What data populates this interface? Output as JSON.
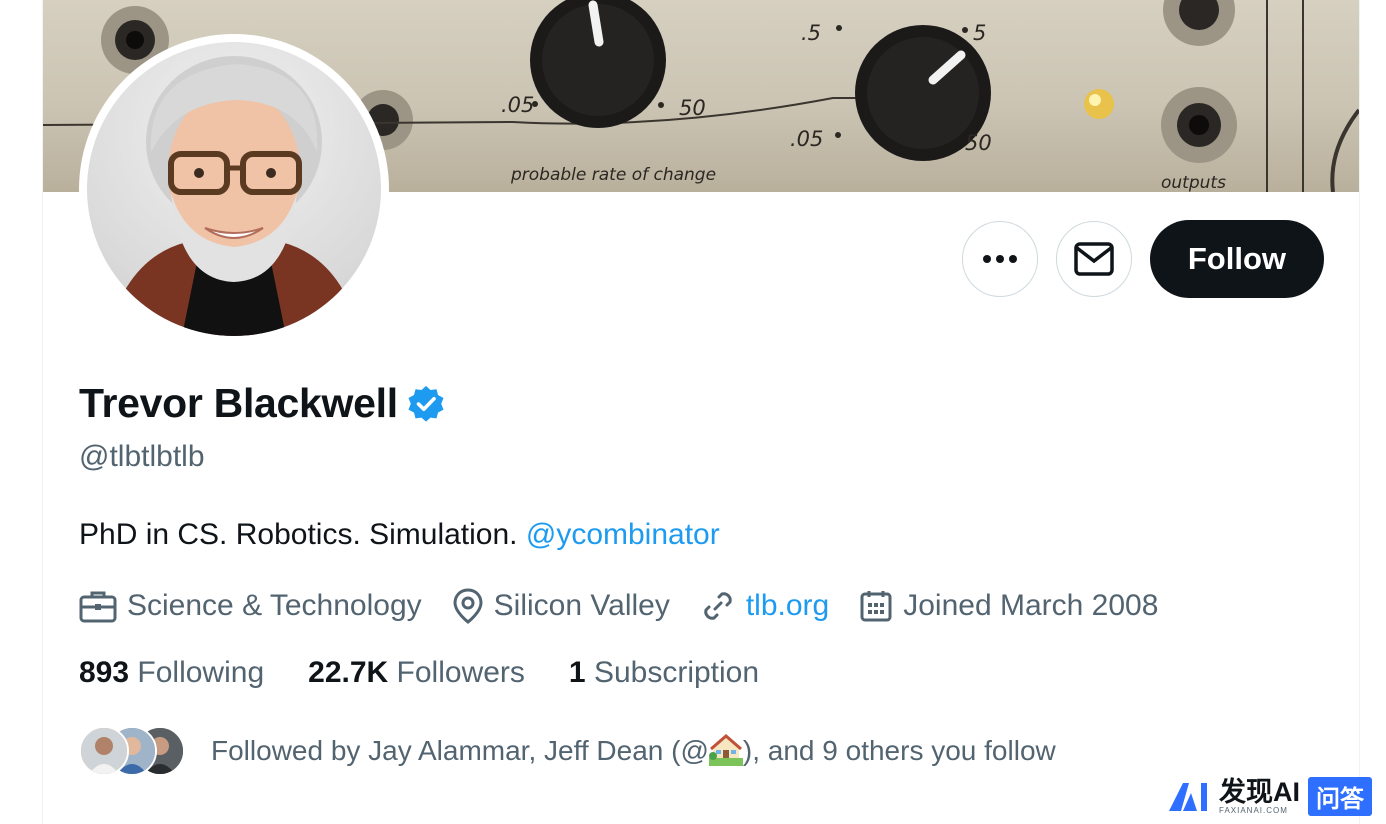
{
  "colors": {
    "accent": "#1d9bf0",
    "text": "#0f1419",
    "muted": "#536471",
    "border": "#cfd9de"
  },
  "banner": {
    "knob_labels": [
      ".05",
      "50",
      ".5",
      "5",
      ".05",
      "50"
    ],
    "caption": "probable rate of change",
    "outputs": "outputs"
  },
  "actions": {
    "more_icon": "more-horizontal-icon",
    "message_icon": "envelope-icon",
    "follow_label": "Follow"
  },
  "profile": {
    "name": "Trevor Blackwell",
    "verified_icon": "verified-badge-icon",
    "handle": "@tlbtlbtlb",
    "bio_text": "PhD in CS. Robotics. Simulation. ",
    "bio_mention": "@ycombinator"
  },
  "meta": {
    "category": "Science & Technology",
    "location": "Silicon Valley",
    "website": "tlb.org",
    "joined": "Joined March 2008"
  },
  "stats": {
    "following_count": "893",
    "following_label": "Following",
    "followers_count": "22.7K",
    "followers_label": "Followers",
    "subscription_count": "1",
    "subscription_label": "Subscription"
  },
  "followed_by": {
    "prefix": "Followed by Jay Alammar, Jeff Dean (@",
    "suffix": "), and 9 others you follow"
  },
  "watermark": {
    "brand": "发现AI",
    "domain": "FAXIANAI.COM",
    "badge": "问答"
  }
}
